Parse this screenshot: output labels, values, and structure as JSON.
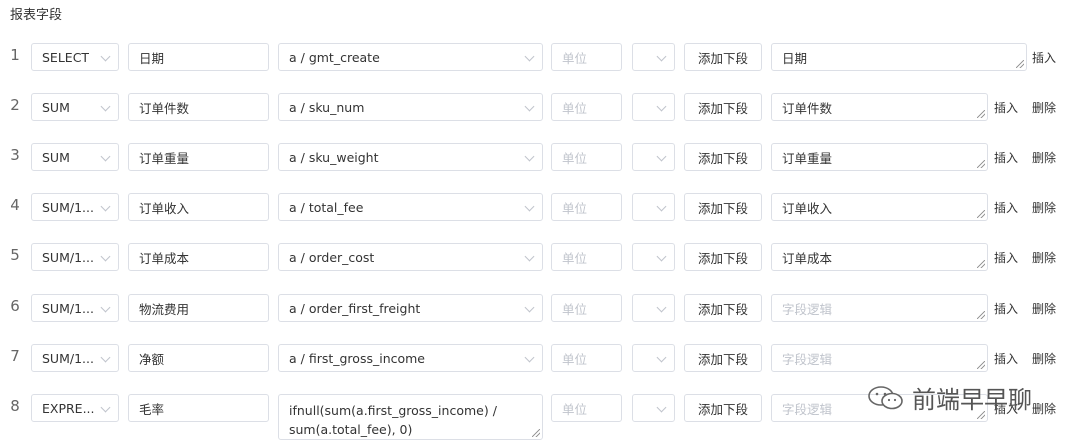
{
  "section_title": "报表字段",
  "add_sub_label": "添加下段",
  "unit_placeholder": "单位",
  "logic_placeholder": "字段逻辑",
  "insert_label": "插入",
  "delete_label": "删除",
  "rows": [
    {
      "num": "1",
      "agg": "SELECT",
      "name": "日期",
      "field": "a / gmt_create",
      "logic": "日期"
    },
    {
      "num": "2",
      "agg": "SUM",
      "name": "订单件数",
      "field": "a / sku_num",
      "logic": "订单件数"
    },
    {
      "num": "3",
      "agg": "SUM",
      "name": "订单重量",
      "field": "a / sku_weight",
      "logic": "订单重量"
    },
    {
      "num": "4",
      "agg": "SUM/1...",
      "name": "订单收入",
      "field": "a / total_fee",
      "logic": "订单收入"
    },
    {
      "num": "5",
      "agg": "SUM/1...",
      "name": "订单成本",
      "field": "a / order_cost",
      "logic": "订单成本"
    },
    {
      "num": "6",
      "agg": "SUM/1...",
      "name": "物流费用",
      "field": "a / order_first_freight",
      "logic": ""
    },
    {
      "num": "7",
      "agg": "SUM/1...",
      "name": "净额",
      "field": "a / first_gross_income",
      "logic": ""
    },
    {
      "num": "8",
      "agg": "EXPRE...",
      "name": "毛率",
      "field": "ifnull(sum(a.first_gross_income) / sum(a.total_fee), 0)",
      "logic": ""
    }
  ],
  "watermark_text": "前端早早聊"
}
